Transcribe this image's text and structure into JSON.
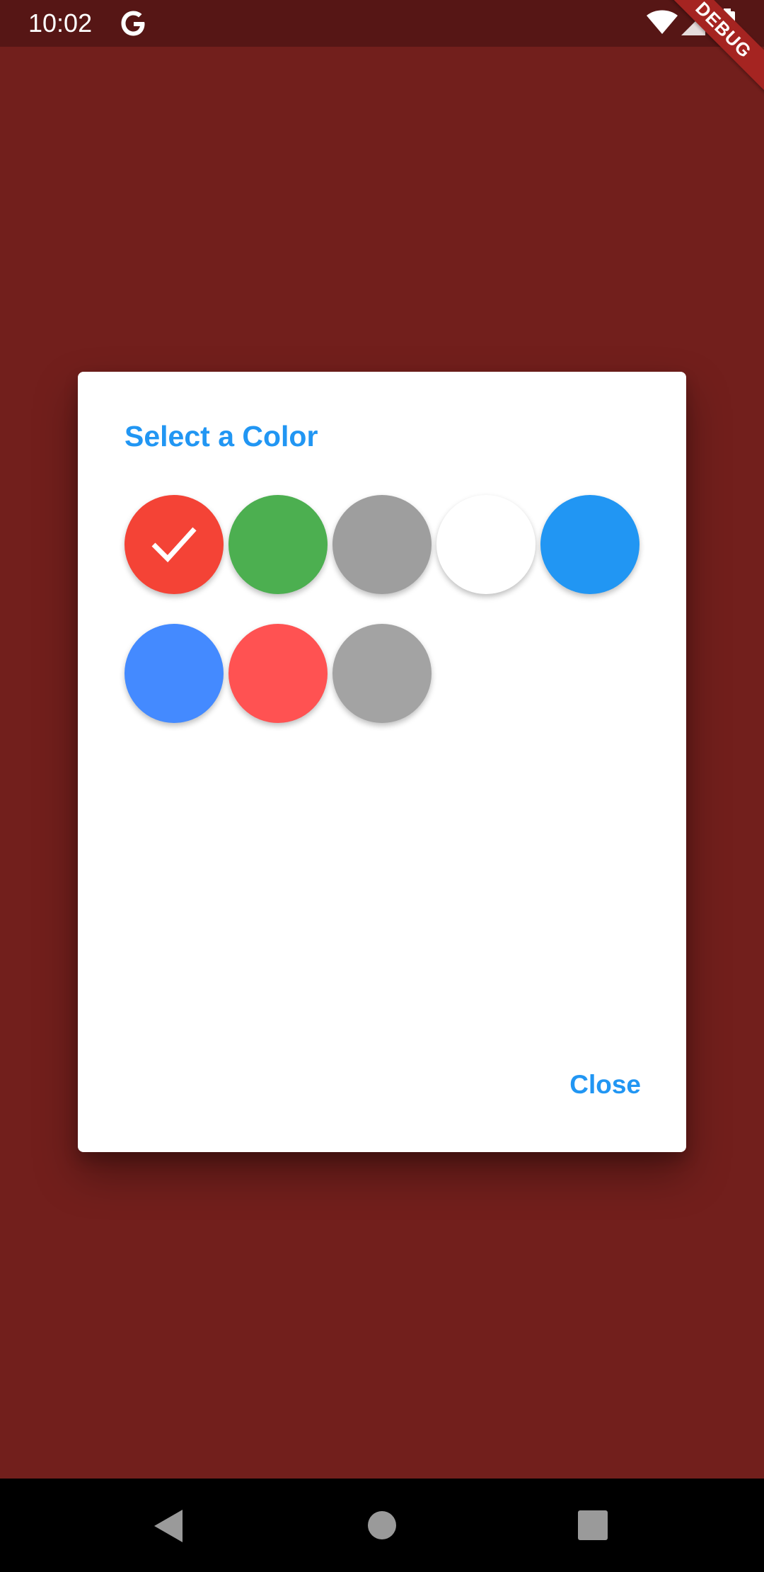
{
  "status_bar": {
    "time": "10:02",
    "icons": [
      "google-g-icon",
      "wifi-icon",
      "signal-icon",
      "battery-icon"
    ]
  },
  "debug_banner": {
    "label": "DEBUG"
  },
  "dialog": {
    "title": "Select a Color",
    "selected_index": 0,
    "swatches": [
      {
        "color": "#f44336",
        "selected": true
      },
      {
        "color": "#4caf50",
        "selected": false
      },
      {
        "color": "#9e9e9e",
        "selected": false
      },
      {
        "color": "#ffffff",
        "selected": false
      },
      {
        "color": "#2196f3",
        "selected": false
      },
      {
        "color": "#448aff",
        "selected": false
      },
      {
        "color": "#ff5252",
        "selected": false
      },
      {
        "color": "#a3a3a3",
        "selected": false
      }
    ],
    "close_label": "Close"
  },
  "nav_bar": {
    "icons": [
      "back-icon",
      "home-icon",
      "recents-icon"
    ]
  },
  "colors": {
    "background": "#721f1c",
    "status_bar": "#561615",
    "accent": "#2196f3"
  }
}
